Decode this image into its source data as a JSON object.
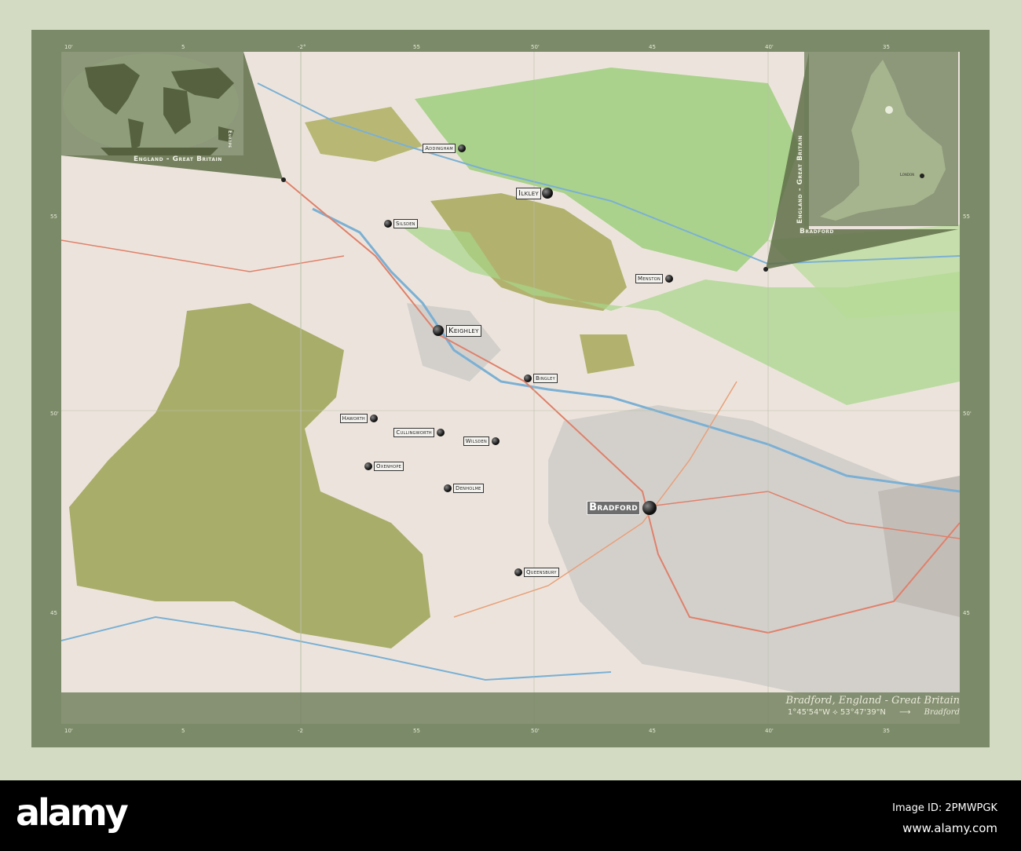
{
  "map": {
    "title": "Bradford, England - Great Britain",
    "coordinates": "1°45'54\"W ⟡ 53°47'39\"N",
    "arrow": "⟶",
    "region_name": "Bradford",
    "cities": [
      {
        "name": "Addingham",
        "size": "small"
      },
      {
        "name": "Ilkley",
        "size": "medium"
      },
      {
        "name": "Silsden",
        "size": "small"
      },
      {
        "name": "Menston",
        "size": "small"
      },
      {
        "name": "Keighley",
        "size": "medium"
      },
      {
        "name": "Bingley",
        "size": "small"
      },
      {
        "name": "Haworth",
        "size": "small"
      },
      {
        "name": "Cullingworth",
        "size": "small"
      },
      {
        "name": "Wilsden",
        "size": "small"
      },
      {
        "name": "Oxenhope",
        "size": "small"
      },
      {
        "name": "Denholme",
        "size": "small"
      },
      {
        "name": "Bradford",
        "size": "capital"
      },
      {
        "name": "Queensbury",
        "size": "small"
      }
    ],
    "ticks_top": [
      "10'",
      "5",
      "-2°",
      "55",
      "50'",
      "45",
      "40'",
      "35"
    ],
    "ticks_bottom": [
      "10'",
      "5",
      "-2",
      "55",
      "50'",
      "45",
      "40'",
      "35"
    ],
    "ticks_side": [
      "55",
      "50'",
      "45"
    ]
  },
  "insets": {
    "world": {
      "title": "England - Great Britain",
      "sublabel": "Europe"
    },
    "country": {
      "title": "England - Great Britain",
      "sublabel": "Bradford",
      "capital": "London"
    }
  },
  "watermark": {
    "logo": "alamy",
    "image_id": "Image ID: 2PMWPGK",
    "url": "www.alamy.com"
  },
  "colors": {
    "frame": "#7b8a68",
    "background": "#d3dcc3",
    "moor": "#a9ad6a",
    "forest": "#8cc06a",
    "urban": "#c9c7c4"
  }
}
